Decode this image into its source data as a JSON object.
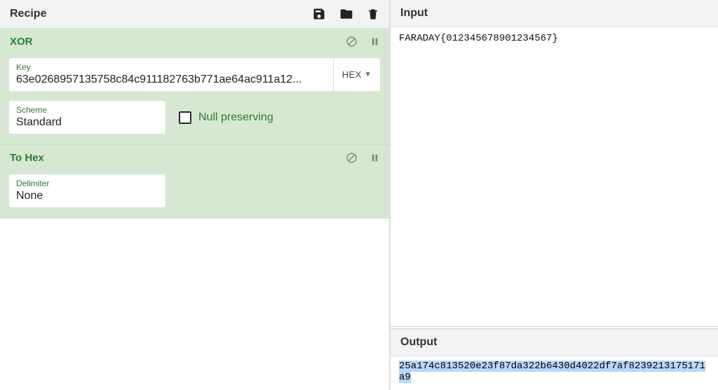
{
  "recipe": {
    "title": "Recipe",
    "icons": {
      "save": "save-icon",
      "load": "folder-icon",
      "clear": "trash-icon"
    }
  },
  "ops": [
    {
      "name": "XOR",
      "key": {
        "label": "Key",
        "value": "63e0268957135758c84c911182763b771ae64ac911a12...",
        "format": "HEX"
      },
      "scheme": {
        "label": "Scheme",
        "value": "Standard"
      },
      "null_preserving": {
        "label": "Null preserving",
        "checked": false
      }
    },
    {
      "name": "To Hex",
      "delimiter": {
        "label": "Delimiter",
        "value": "None"
      }
    }
  ],
  "input": {
    "title": "Input",
    "value": "FARADAY{012345678901234567}"
  },
  "output": {
    "title": "Output",
    "value": "25a174c813520e23f87da322b6430d4022df7af8239213175171a9"
  }
}
